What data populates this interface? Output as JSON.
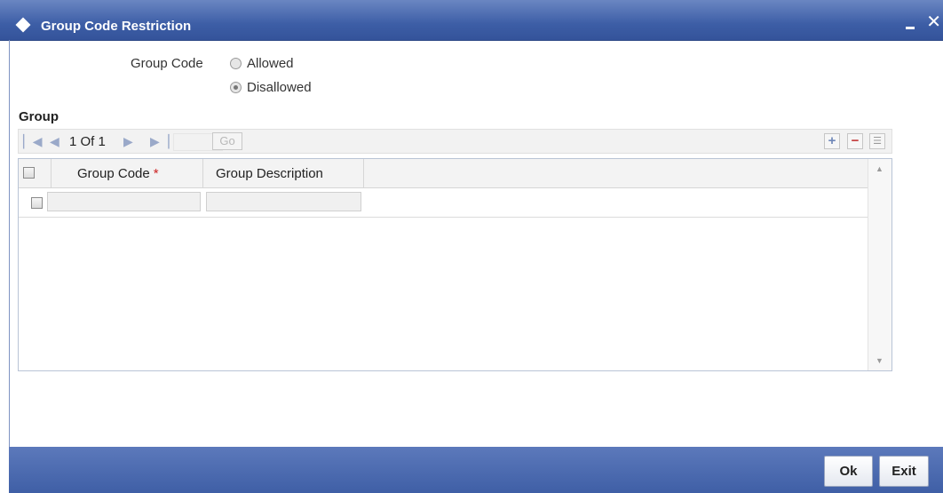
{
  "window": {
    "title": "Group Code Restriction"
  },
  "restriction": {
    "label": "Group Code",
    "options": [
      "Allowed",
      "Disallowed"
    ],
    "selected": "Disallowed"
  },
  "group_section": {
    "title": "Group",
    "pager": {
      "page_text": "1 Of 1",
      "go_label": "Go"
    },
    "columns": [
      "Group Code",
      "Group Description"
    ],
    "required_marker": "*",
    "rows": [
      {
        "group_code": "",
        "group_description": ""
      }
    ]
  },
  "footer": {
    "ok_label": "Ok",
    "exit_label": "Exit"
  }
}
